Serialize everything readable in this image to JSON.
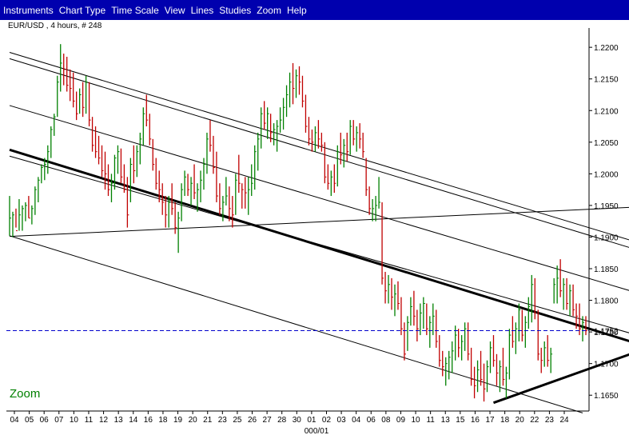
{
  "menu": {
    "items": [
      "Instruments",
      "Chart Type",
      "Time Scale",
      "View",
      "Lines",
      "Studies",
      "Zoom",
      "Help"
    ]
  },
  "chart": {
    "title": "EUR/USD , 4 hours, # 248",
    "zoom_label": "Zoom",
    "month_label": "000/01",
    "current_price_label": "1.1752"
  },
  "chart_data": {
    "type": "bar",
    "style": "ohlc",
    "title": "EUR/USD , 4 hours, # 248",
    "x_tick_labels": [
      "04",
      "05",
      "06",
      "07",
      "10",
      "11",
      "12",
      "13",
      "14",
      "16",
      "18",
      "19",
      "20",
      "21",
      "23",
      "25",
      "26",
      "27",
      "28",
      "30",
      "01",
      "02",
      "03",
      "04",
      "06",
      "08",
      "09",
      "10",
      "11",
      "13",
      "15",
      "16",
      "17",
      "18",
      "20",
      "22",
      "23",
      "24"
    ],
    "x_month_label": "000/01",
    "y_ticks": [
      1.165,
      1.17,
      1.175,
      1.18,
      1.185,
      1.19,
      1.195,
      1.2,
      1.205,
      1.21,
      1.215,
      1.22
    ],
    "y_tick_labels": [
      "1.1650",
      "1.1700",
      "1.1750",
      "1.1800",
      "1.1850",
      "1.1900",
      "1.1950",
      "1.2000",
      "1.2050",
      "1.2100",
      "1.2150",
      "1.2200"
    ],
    "ylim": [
      1.1625,
      1.2228
    ],
    "current_price": 1.1752,
    "grid": false,
    "colors": {
      "up": "#008000",
      "down": "#c00000",
      "price_line": "#0000cc",
      "trendline": "#000000",
      "zoom_text": "#008000",
      "menubar": "#0000ae"
    },
    "series": [
      {
        "values": [
          [
            1.1965,
            1.1902,
            1.193
          ],
          [
            1.194,
            1.19,
            1.1935
          ],
          [
            1.1945,
            1.1915,
            1.191
          ],
          [
            1.196,
            1.191,
            1.1935
          ],
          [
            1.195,
            1.191,
            1.1945
          ],
          [
            1.1955,
            1.1925,
            1.195
          ],
          [
            1.1965,
            1.193,
            1.193
          ],
          [
            1.195,
            1.192,
            1.1945
          ],
          [
            1.198,
            1.1935,
            1.1975
          ],
          [
            1.1995,
            1.1955,
            1.199
          ],
          [
            1.2015,
            1.1985,
            1.201
          ],
          [
            1.2025,
            1.199,
            1.2015
          ],
          [
            1.2045,
            1.2,
            1.2035
          ],
          [
            1.2075,
            1.2025,
            1.207
          ],
          [
            1.2095,
            1.206,
            1.209
          ],
          [
            1.2155,
            1.209,
            1.2145
          ],
          [
            1.2205,
            1.213,
            1.2175
          ],
          [
            1.219,
            1.214,
            1.2165
          ],
          [
            1.2185,
            1.213,
            1.214
          ],
          [
            1.2165,
            1.2115,
            1.2135
          ],
          [
            1.216,
            1.2105,
            1.2115
          ],
          [
            1.213,
            1.2085,
            1.2095
          ],
          [
            1.2135,
            1.2095,
            1.2125
          ],
          [
            1.2145,
            1.209,
            1.2105
          ],
          [
            1.2155,
            1.2095,
            1.2145
          ],
          [
            1.2145,
            1.2075,
            1.2085
          ],
          [
            1.209,
            1.2035,
            1.2045
          ],
          [
            1.2075,
            1.2025,
            1.2035
          ],
          [
            1.206,
            1.2015,
            1.2025
          ],
          [
            1.2045,
            1.1995,
            1.2005
          ],
          [
            1.2035,
            1.1975,
            1.2
          ],
          [
            1.2015,
            1.1965,
            1.1975
          ],
          [
            1.2,
            1.1955,
            1.1985
          ],
          [
            1.203,
            1.1975,
            1.2025
          ],
          [
            1.2045,
            1.2,
            1.2035
          ],
          [
            1.204,
            1.1985,
            1.1995
          ],
          [
            1.2015,
            1.197,
            1.1975
          ],
          [
            1.1995,
            1.1915,
            1.1935
          ],
          [
            1.2025,
            1.1955,
            1.2015
          ],
          [
            1.2045,
            1.1985,
            1.2005
          ],
          [
            1.2045,
            1.1995,
            1.2035
          ],
          [
            1.2065,
            1.2015,
            1.2055
          ],
          [
            1.2105,
            1.2045,
            1.2095
          ],
          [
            1.2125,
            1.2075,
            1.2085
          ],
          [
            1.2095,
            1.2045,
            1.2055
          ],
          [
            1.2055,
            1.2005,
            1.2015
          ],
          [
            1.2025,
            1.1975,
            1.1985
          ],
          [
            1.2005,
            1.1955,
            1.1975
          ],
          [
            1.1985,
            1.1935,
            1.1955
          ],
          [
            1.1965,
            1.1915,
            1.1935
          ],
          [
            1.1965,
            1.1915,
            1.1955
          ],
          [
            1.1985,
            1.1935,
            1.1945
          ],
          [
            1.1955,
            1.1905,
            1.1915
          ],
          [
            1.194,
            1.1875,
            1.193
          ],
          [
            1.1985,
            1.1925,
            1.1975
          ],
          [
            1.2005,
            1.1965,
            1.1995
          ],
          [
            1.2,
            1.1965,
            1.1975
          ],
          [
            1.1995,
            1.195,
            1.1985
          ],
          [
            1.2015,
            1.196,
            1.197
          ],
          [
            1.1985,
            1.194,
            1.1975
          ],
          [
            1.2005,
            1.1955,
            1.199
          ],
          [
            1.2025,
            1.1975,
            1.2015
          ],
          [
            1.2065,
            1.2,
            1.2055
          ],
          [
            1.2085,
            1.2035,
            1.2045
          ],
          [
            1.206,
            1.2,
            1.201
          ],
          [
            1.2035,
            1.1955,
            1.1965
          ],
          [
            1.1985,
            1.1935,
            1.1945
          ],
          [
            1.1965,
            1.1925,
            1.1955
          ],
          [
            1.1995,
            1.195,
            1.1965
          ],
          [
            1.198,
            1.1925,
            1.1945
          ],
          [
            1.1965,
            1.1915,
            1.1935
          ],
          [
            1.2,
            1.1935,
            1.199
          ],
          [
            1.203,
            1.197,
            1.1985
          ],
          [
            1.1985,
            1.1945,
            1.1975
          ],
          [
            1.1995,
            1.1945,
            1.197
          ],
          [
            1.1995,
            1.1935,
            1.1975
          ],
          [
            1.2015,
            1.1965,
            1.1985
          ],
          [
            1.2045,
            1.1975,
            1.2035
          ],
          [
            1.2065,
            1.2005,
            1.2055
          ],
          [
            1.2105,
            1.204,
            1.2095
          ],
          [
            1.2115,
            1.207,
            1.208
          ],
          [
            1.2105,
            1.2055,
            1.2095
          ],
          [
            1.2095,
            1.205,
            1.2065
          ],
          [
            1.208,
            1.2045,
            1.207
          ],
          [
            1.2085,
            1.2035,
            1.2075
          ],
          [
            1.2105,
            1.2065,
            1.2085
          ],
          [
            1.212,
            1.207,
            1.2105
          ],
          [
            1.214,
            1.209,
            1.2125
          ],
          [
            1.216,
            1.2105,
            1.2145
          ],
          [
            1.2175,
            1.211,
            1.2135
          ],
          [
            1.2165,
            1.212,
            1.2155
          ],
          [
            1.217,
            1.2125,
            1.2145
          ],
          [
            1.2155,
            1.2105,
            1.2115
          ],
          [
            1.2125,
            1.2065,
            1.2075
          ],
          [
            1.209,
            1.2045,
            1.2055
          ],
          [
            1.207,
            1.2035,
            1.205
          ],
          [
            1.2075,
            1.2035,
            1.2065
          ],
          [
            1.2085,
            1.204,
            1.2055
          ],
          [
            1.2065,
            1.2035,
            1.2045
          ],
          [
            1.205,
            1.1985,
            1.1995
          ],
          [
            1.2015,
            1.1975,
            1.1985
          ],
          [
            1.2005,
            1.1965,
            1.1995
          ],
          [
            1.2015,
            1.197,
            1.1985
          ],
          [
            1.2045,
            1.198,
            1.2035
          ],
          [
            1.2065,
            1.2015,
            1.203
          ],
          [
            1.2055,
            1.201,
            1.2045
          ],
          [
            1.2065,
            1.202,
            1.2035
          ],
          [
            1.2085,
            1.203,
            1.2075
          ],
          [
            1.2085,
            1.2045,
            1.2055
          ],
          [
            1.2075,
            1.2035,
            1.2065
          ],
          [
            1.208,
            1.204,
            1.2055
          ],
          [
            1.2065,
            1.2025,
            1.2035
          ],
          [
            1.2025,
            1.1965,
            1.1975
          ],
          [
            1.198,
            1.1935,
            1.1945
          ],
          [
            1.196,
            1.1925,
            1.1945
          ],
          [
            1.1965,
            1.1925,
            1.195
          ],
          [
            1.1995,
            1.1945,
            1.1955
          ],
          [
            1.1955,
            1.1825,
            1.1835
          ],
          [
            1.1845,
            1.1795,
            1.1815
          ],
          [
            1.184,
            1.1795,
            1.1825
          ],
          [
            1.1835,
            1.1785,
            1.1805
          ],
          [
            1.1825,
            1.1775,
            1.181
          ],
          [
            1.183,
            1.1785,
            1.1795
          ],
          [
            1.1805,
            1.1745,
            1.1755
          ],
          [
            1.1765,
            1.1705,
            1.1715
          ],
          [
            1.1775,
            1.172,
            1.1765
          ],
          [
            1.1805,
            1.176,
            1.179
          ],
          [
            1.1815,
            1.176,
            1.1775
          ],
          [
            1.1785,
            1.1735,
            1.1755
          ],
          [
            1.1795,
            1.1745,
            1.178
          ],
          [
            1.1805,
            1.1755,
            1.1795
          ],
          [
            1.1795,
            1.1745,
            1.1755
          ],
          [
            1.1775,
            1.1725,
            1.1765
          ],
          [
            1.1795,
            1.1745,
            1.1775
          ],
          [
            1.1785,
            1.1725,
            1.1735
          ],
          [
            1.1745,
            1.1695,
            1.1705
          ],
          [
            1.172,
            1.168,
            1.1695
          ],
          [
            1.171,
            1.1665,
            1.17
          ],
          [
            1.172,
            1.1675,
            1.171
          ],
          [
            1.1735,
            1.1685,
            1.172
          ],
          [
            1.176,
            1.1705,
            1.1745
          ],
          [
            1.1755,
            1.171,
            1.1725
          ],
          [
            1.1745,
            1.1705,
            1.1735
          ],
          [
            1.1765,
            1.172,
            1.1755
          ],
          [
            1.1765,
            1.1705,
            1.1715
          ],
          [
            1.1725,
            1.1665,
            1.1675
          ],
          [
            1.1695,
            1.1645,
            1.1665
          ],
          [
            1.1705,
            1.1655,
            1.169
          ],
          [
            1.172,
            1.1665,
            1.1675
          ],
          [
            1.17,
            1.164,
            1.166
          ],
          [
            1.1705,
            1.1655,
            1.1695
          ],
          [
            1.1735,
            1.1685,
            1.1725
          ],
          [
            1.1745,
            1.1695,
            1.1705
          ],
          [
            1.1715,
            1.1665,
            1.1685
          ],
          [
            1.1705,
            1.1655,
            1.1695
          ],
          [
            1.1725,
            1.1665,
            1.1675
          ],
          [
            1.1695,
            1.1645,
            1.1685
          ],
          [
            1.1755,
            1.1675,
            1.1745
          ],
          [
            1.1775,
            1.1725,
            1.1735
          ],
          [
            1.1765,
            1.1715,
            1.1755
          ],
          [
            1.1795,
            1.1735,
            1.1785
          ],
          [
            1.1785,
            1.1735,
            1.1745
          ],
          [
            1.1775,
            1.1725,
            1.1765
          ],
          [
            1.1805,
            1.1755,
            1.179
          ],
          [
            1.184,
            1.1765,
            1.1825
          ],
          [
            1.1835,
            1.177,
            1.178
          ],
          [
            1.1785,
            1.1705,
            1.1715
          ],
          [
            1.1725,
            1.1685,
            1.1705
          ],
          [
            1.1735,
            1.1695,
            1.1725
          ],
          [
            1.1745,
            1.1695,
            1.1705
          ],
          [
            1.1725,
            1.1685,
            1.1715
          ],
          [
            1.1835,
            1.1795,
            1.1825
          ],
          [
            1.1855,
            1.1795,
            1.1835
          ],
          [
            1.1865,
            1.1805,
            1.1815
          ],
          [
            1.1835,
            1.1785,
            1.1825
          ],
          [
            1.1835,
            1.1785,
            1.1795
          ],
          [
            1.1825,
            1.1775,
            1.1815
          ],
          [
            1.1825,
            1.1775,
            1.1785
          ],
          [
            1.1795,
            1.1755,
            1.1775
          ],
          [
            1.1795,
            1.1745,
            1.1755
          ],
          [
            1.1775,
            1.1735,
            1.1765
          ],
          [
            1.1775,
            1.1745,
            1.1752
          ]
        ]
      }
    ],
    "trendlines": [
      {
        "weight": "bold",
        "p1": [
          0,
          1.2038
        ],
        "p2": [
          195,
          1.1735
        ]
      },
      {
        "weight": "bold",
        "p1": [
          152,
          1.1638
        ],
        "p2": [
          195,
          1.1715
        ]
      },
      {
        "weight": "thin",
        "p1": [
          0,
          1.2028
        ],
        "p2": [
          195,
          1.1748
        ]
      },
      {
        "weight": "thin",
        "p1": [
          0,
          1.2192
        ],
        "p2": [
          195,
          1.1895
        ]
      },
      {
        "weight": "thin",
        "p1": [
          0,
          1.2182
        ],
        "p2": [
          195,
          1.1883
        ]
      },
      {
        "weight": "thin",
        "p1": [
          0,
          1.2108
        ],
        "p2": [
          195,
          1.1815
        ]
      },
      {
        "weight": "thin",
        "p1": [
          0,
          1.1902
        ],
        "p2": [
          180,
          1.1622
        ]
      },
      {
        "weight": "thin",
        "p1": [
          0,
          1.1901
        ],
        "p2": [
          195,
          1.1947
        ]
      }
    ]
  }
}
